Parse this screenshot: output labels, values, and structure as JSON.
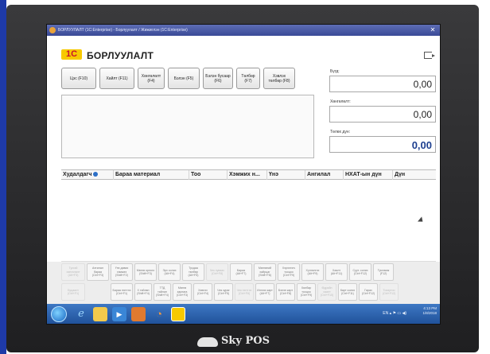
{
  "window": {
    "title": "БОРЛУУЛАЛТ (1C:Enterprise) - Борлуулалт / Жижиглэн (1C:Enterprise)"
  },
  "app": {
    "title": "БОРЛУУЛАЛТ",
    "logo_text": "1С"
  },
  "toolbar": {
    "buttons": [
      {
        "label": "Цэс (F10)"
      },
      {
        "label": "Хайлт (F11)"
      },
      {
        "label": "Хөнгөлөлт (F4)"
      },
      {
        "label": "Бэлэн (F5)"
      },
      {
        "label": "Бэлэн бусаар (F6)"
      },
      {
        "label": "Төлбөр (F7)"
      },
      {
        "label": "Хэвлэх төлбөр (F8)"
      }
    ]
  },
  "summary": {
    "sum_label": "Бүгд:",
    "sum_value": "0,00",
    "discount_label": "Хөнгөлөлт:",
    "discount_value": "0,00",
    "pay_label": "Төлөх дүн:",
    "pay_value": "0,00"
  },
  "grid": {
    "columns": [
      {
        "label": "Худалдагч"
      },
      {
        "label": "Бараа материал"
      },
      {
        "label": "Тоо"
      },
      {
        "label": "Хэмжих н..."
      },
      {
        "label": "Үнэ"
      },
      {
        "label": "Ангилал"
      },
      {
        "label": "НХАТ-ын дүн"
      },
      {
        "label": "Дүн"
      }
    ]
  },
  "fkeys": {
    "row1": [
      {
        "label": "Тусгай хөнгөлөлт (Alt+F3)"
      },
      {
        "label": "Ангилал бараа (Ctrl+F3)"
      },
      {
        "label": "Үнэ давах хэмжээ (Shift+F2)"
      },
      {
        "label": "Мөнгө орлого (Shift+F3)"
      },
      {
        "label": "Эрх солих (Alt+F4)"
      },
      {
        "label": "Тусдаа төлбөр (Alt+F5)"
      },
      {
        "label": "Чек хуваах (Ctrl+F8)"
      },
      {
        "label": "Бараа (Alt+F7)"
      },
      {
        "label": "Мөнгөний хайрцаг (Shift+F8)"
      },
      {
        "label": "Хэрэглэгч тооцоо (Ctrl+F9)"
      },
      {
        "label": "Хүлээлгэх (Alt+F9)"
      },
      {
        "label": "Хаалт (Alt+F11)"
      },
      {
        "label": "Суут. солих (Ctrl+F12)"
      },
      {
        "label": "Тусламж (F12)"
      }
    ],
    "row2": [
      {
        "label": "Буцаалт (Ctrl+F1)"
      },
      {
        "label": "Бараа нэгтгэх (Ctrl+F1)"
      },
      {
        "label": "X тайлан (Shift+F4)"
      },
      {
        "label": "ТТД тайлан (Shift+F4)"
      },
      {
        "label": "Мөнгө зарлага (Ctrl+F3)"
      },
      {
        "label": "Хэвлэх (Ctrl+F4)"
      },
      {
        "label": "Чек зураг (Ctrl+F5)"
      },
      {
        "label": "Чек нэгтгэх (Ctrl+F6)"
      },
      {
        "label": "Илгээх карт (Alt+F7)"
      },
      {
        "label": "Бэлэн карт (Ctrl+F8)"
      },
      {
        "label": "Хялбар тооцоо (Ctrl+F9)"
      },
      {
        "label": "Өдрийн хаалт (Ctrl+F10)"
      },
      {
        "label": "Карт солих (Ctrl+F11)"
      },
      {
        "label": "Гарах (Ctrl+F12)"
      },
      {
        "label": "Тохиргоо (Ctrl+F12)"
      }
    ]
  },
  "taskbar": {
    "tray_lang": "EN",
    "time": "4:13 PM",
    "date": "1/8/2018"
  },
  "device": {
    "brand": "Sky POS"
  },
  "colors": {
    "accent": "#1d3f8f",
    "titlebar": "#3a4a97",
    "logo_bg": "#f7c900",
    "logo_fg": "#c8102e"
  }
}
